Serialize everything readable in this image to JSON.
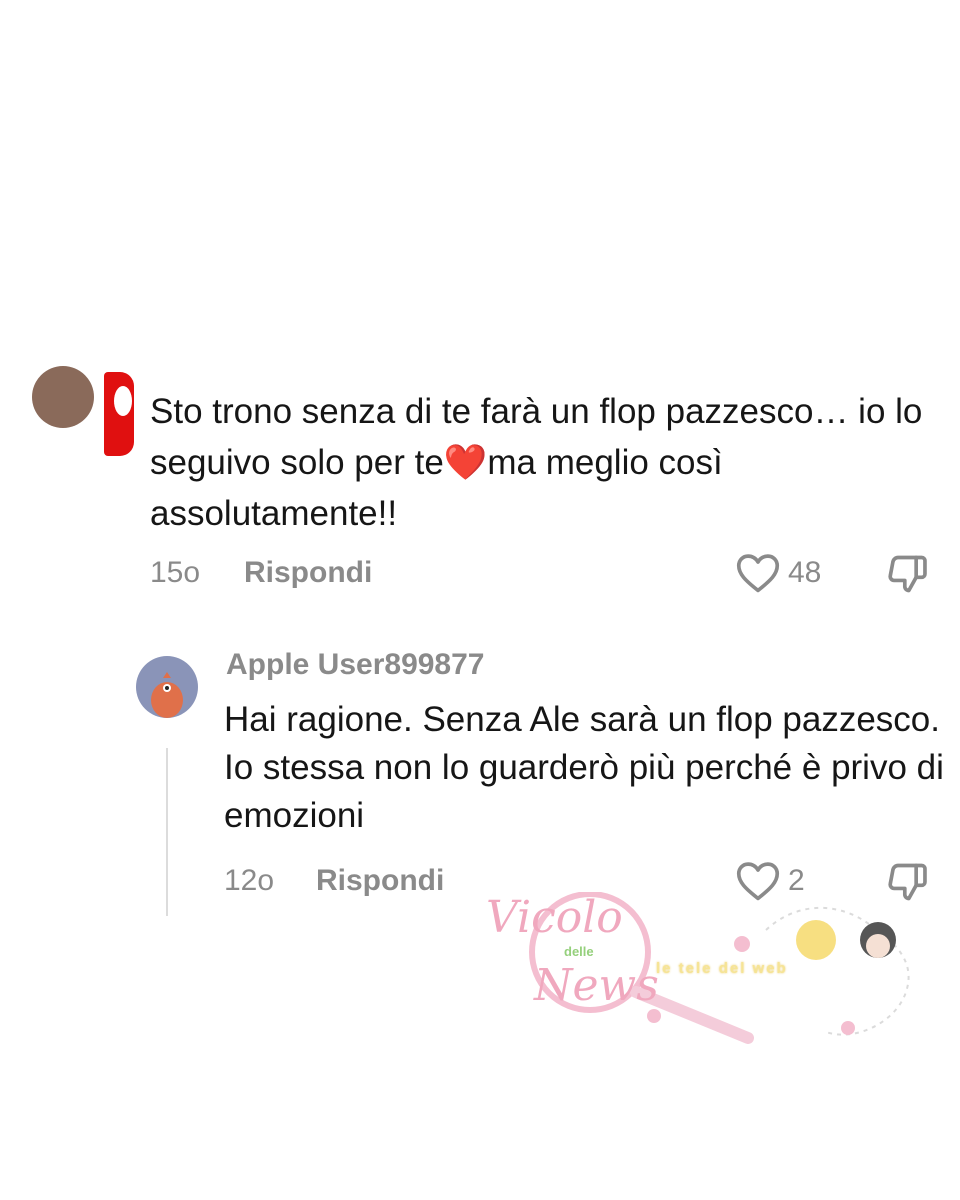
{
  "comment": {
    "text": "Sto trono senza di te farà un flop pazzesco… io lo seguivo solo per te❤️ma meglio così assolutamente!!",
    "time": "15o",
    "reply_label": "Rispondi",
    "likes": "48"
  },
  "reply": {
    "username": "Apple User899877",
    "text": "Hai ragione. Senza Ale sarà un flop pazzesco. Io stessa non lo guarderò più perché è privo di emozioni",
    "time": "12o",
    "reply_label": "Rispondi",
    "likes": "2"
  },
  "watermark": {
    "brand_line1": "Vicolo",
    "brand_sub": "delle",
    "brand_line2": "News",
    "tagline": "le tele del web"
  },
  "colors": {
    "text_primary": "#161616",
    "text_secondary": "#8a8a8a",
    "accent_red": "#e01010",
    "watermark_pink": "#ef9fb8"
  },
  "icons": {
    "like": "heart-outline-icon",
    "dislike": "thumbs-down-outline-icon"
  }
}
